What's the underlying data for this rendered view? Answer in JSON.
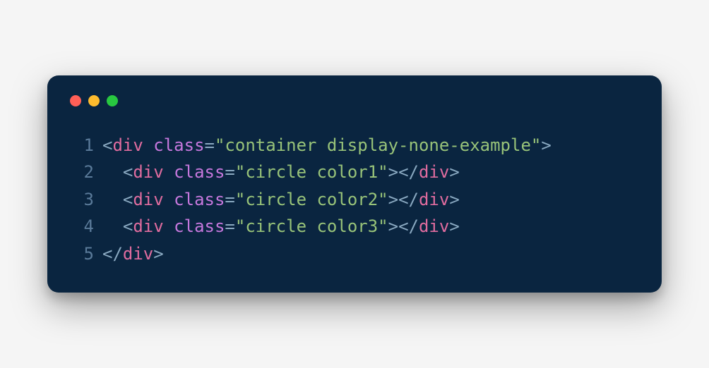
{
  "colors": {
    "background": "#0a2540",
    "traffic_red": "#ff5f57",
    "traffic_yellow": "#febc2e",
    "traffic_green": "#28c840",
    "lineno": "#5a7a99",
    "punct": "#8aa9c1",
    "tag": "#e06c9f",
    "attr": "#c678dd",
    "string": "#98c379"
  },
  "code": {
    "lines": [
      {
        "n": "1",
        "tokens": [
          {
            "cls": "punct",
            "t": "<"
          },
          {
            "cls": "tag",
            "t": "div"
          },
          {
            "cls": "punct",
            "t": " "
          },
          {
            "cls": "attr",
            "t": "class"
          },
          {
            "cls": "punct",
            "t": "="
          },
          {
            "cls": "str",
            "t": "\"container display-none-example\""
          },
          {
            "cls": "punct",
            "t": ">"
          }
        ]
      },
      {
        "n": "2",
        "tokens": [
          {
            "cls": "punct",
            "t": "  <"
          },
          {
            "cls": "tag",
            "t": "div"
          },
          {
            "cls": "punct",
            "t": " "
          },
          {
            "cls": "attr",
            "t": "class"
          },
          {
            "cls": "punct",
            "t": "="
          },
          {
            "cls": "str",
            "t": "\"circle color1\""
          },
          {
            "cls": "punct",
            "t": "></"
          },
          {
            "cls": "tag",
            "t": "div"
          },
          {
            "cls": "punct",
            "t": ">"
          }
        ]
      },
      {
        "n": "3",
        "tokens": [
          {
            "cls": "punct",
            "t": "  <"
          },
          {
            "cls": "tag",
            "t": "div"
          },
          {
            "cls": "punct",
            "t": " "
          },
          {
            "cls": "attr",
            "t": "class"
          },
          {
            "cls": "punct",
            "t": "="
          },
          {
            "cls": "str",
            "t": "\"circle color2\""
          },
          {
            "cls": "punct",
            "t": "></"
          },
          {
            "cls": "tag",
            "t": "div"
          },
          {
            "cls": "punct",
            "t": ">"
          }
        ]
      },
      {
        "n": "4",
        "tokens": [
          {
            "cls": "punct",
            "t": "  <"
          },
          {
            "cls": "tag",
            "t": "div"
          },
          {
            "cls": "punct",
            "t": " "
          },
          {
            "cls": "attr",
            "t": "class"
          },
          {
            "cls": "punct",
            "t": "="
          },
          {
            "cls": "str",
            "t": "\"circle color3\""
          },
          {
            "cls": "punct",
            "t": "></"
          },
          {
            "cls": "tag",
            "t": "div"
          },
          {
            "cls": "punct",
            "t": ">"
          }
        ]
      },
      {
        "n": "5",
        "tokens": [
          {
            "cls": "punct",
            "t": "</"
          },
          {
            "cls": "tag",
            "t": "div"
          },
          {
            "cls": "punct",
            "t": ">"
          }
        ]
      }
    ]
  }
}
